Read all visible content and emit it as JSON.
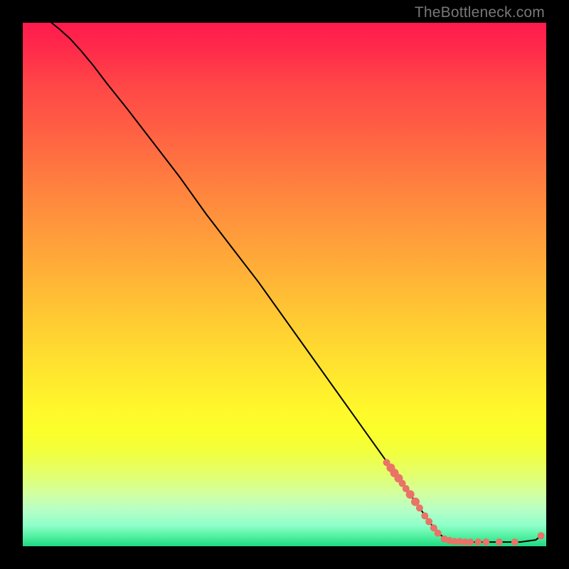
{
  "attribution": "TheBottleneck.com",
  "colors": {
    "marker": "#e97366",
    "curve": "#000000"
  },
  "chart_data": {
    "type": "line",
    "title": "",
    "xlabel": "",
    "ylabel": "",
    "xlim": [
      0,
      100
    ],
    "ylim": [
      0,
      100
    ],
    "grid": false,
    "legend": false,
    "curve": [
      {
        "x": 5.5,
        "y": 100.0
      },
      {
        "x": 7.0,
        "y": 98.8
      },
      {
        "x": 9.0,
        "y": 97.0
      },
      {
        "x": 11.0,
        "y": 94.8
      },
      {
        "x": 13.5,
        "y": 91.8
      },
      {
        "x": 16.0,
        "y": 88.5
      },
      {
        "x": 20.0,
        "y": 83.5
      },
      {
        "x": 25.0,
        "y": 77.0
      },
      {
        "x": 30.0,
        "y": 70.5
      },
      {
        "x": 35.0,
        "y": 63.5
      },
      {
        "x": 40.0,
        "y": 57.0
      },
      {
        "x": 45.0,
        "y": 50.5
      },
      {
        "x": 50.0,
        "y": 43.5
      },
      {
        "x": 55.0,
        "y": 36.5
      },
      {
        "x": 60.0,
        "y": 29.5
      },
      {
        "x": 65.0,
        "y": 22.5
      },
      {
        "x": 70.0,
        "y": 15.5
      },
      {
        "x": 75.0,
        "y": 8.5
      },
      {
        "x": 78.0,
        "y": 4.2
      },
      {
        "x": 80.0,
        "y": 2.0
      },
      {
        "x": 82.0,
        "y": 1.0
      },
      {
        "x": 85.0,
        "y": 0.8
      },
      {
        "x": 90.0,
        "y": 0.8
      },
      {
        "x": 95.0,
        "y": 0.8
      },
      {
        "x": 98.0,
        "y": 1.2
      },
      {
        "x": 99.0,
        "y": 2.0
      }
    ],
    "markers": [
      {
        "x": 69.5,
        "y": 16.0,
        "r": 5
      },
      {
        "x": 70.3,
        "y": 15.0,
        "r": 6
      },
      {
        "x": 71.0,
        "y": 14.0,
        "r": 6
      },
      {
        "x": 71.8,
        "y": 13.0,
        "r": 6
      },
      {
        "x": 72.5,
        "y": 12.0,
        "r": 5
      },
      {
        "x": 73.2,
        "y": 11.0,
        "r": 5
      },
      {
        "x": 74.0,
        "y": 9.9,
        "r": 6
      },
      {
        "x": 75.0,
        "y": 8.5,
        "r": 6
      },
      {
        "x": 75.8,
        "y": 7.3,
        "r": 5
      },
      {
        "x": 76.8,
        "y": 5.8,
        "r": 5
      },
      {
        "x": 77.6,
        "y": 4.7,
        "r": 5
      },
      {
        "x": 78.5,
        "y": 3.5,
        "r": 5
      },
      {
        "x": 79.3,
        "y": 2.5,
        "r": 5
      },
      {
        "x": 80.5,
        "y": 1.4,
        "r": 5
      },
      {
        "x": 81.5,
        "y": 1.1,
        "r": 5
      },
      {
        "x": 82.5,
        "y": 0.9,
        "r": 5
      },
      {
        "x": 83.5,
        "y": 0.9,
        "r": 5
      },
      {
        "x": 84.5,
        "y": 0.8,
        "r": 5
      },
      {
        "x": 85.5,
        "y": 0.8,
        "r": 5
      },
      {
        "x": 87.0,
        "y": 0.8,
        "r": 5
      },
      {
        "x": 88.5,
        "y": 0.8,
        "r": 5
      },
      {
        "x": 91.0,
        "y": 0.8,
        "r": 5
      },
      {
        "x": 94.0,
        "y": 0.8,
        "r": 5
      },
      {
        "x": 99.0,
        "y": 2.0,
        "r": 5
      }
    ]
  }
}
